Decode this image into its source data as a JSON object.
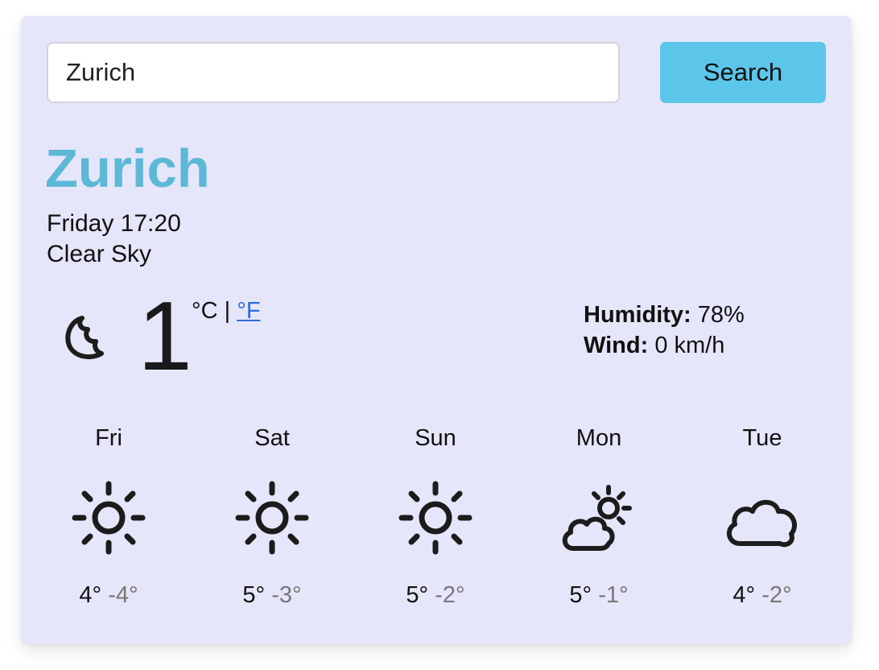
{
  "search": {
    "value": "Zurich",
    "button_label": "Search"
  },
  "current": {
    "city": "Zurich",
    "datetime": "Friday 17:20",
    "description": "Clear Sky",
    "icon": "moon-icon",
    "temperature": "1",
    "unit_celsius": "°C",
    "unit_separator": "|",
    "unit_fahrenheit": "°F",
    "humidity_label": "Humidity:",
    "humidity_value": "78%",
    "wind_label": "Wind:",
    "wind_value": "0 km/h"
  },
  "forecast": [
    {
      "day": "Fri",
      "icon": "sun-icon",
      "max": "4°",
      "min": "-4°"
    },
    {
      "day": "Sat",
      "icon": "sun-icon",
      "max": "5°",
      "min": "-3°"
    },
    {
      "day": "Sun",
      "icon": "sun-icon",
      "max": "5°",
      "min": "-2°"
    },
    {
      "day": "Mon",
      "icon": "partly-cloudy-icon",
      "max": "5°",
      "min": "-1°"
    },
    {
      "day": "Tue",
      "icon": "cloud-icon",
      "max": "4°",
      "min": "-2°"
    }
  ],
  "colors": {
    "card_background": "#e6e6fb",
    "accent": "#5cc6ea",
    "city": "#5db8d6",
    "link": "#2b6cd8"
  }
}
